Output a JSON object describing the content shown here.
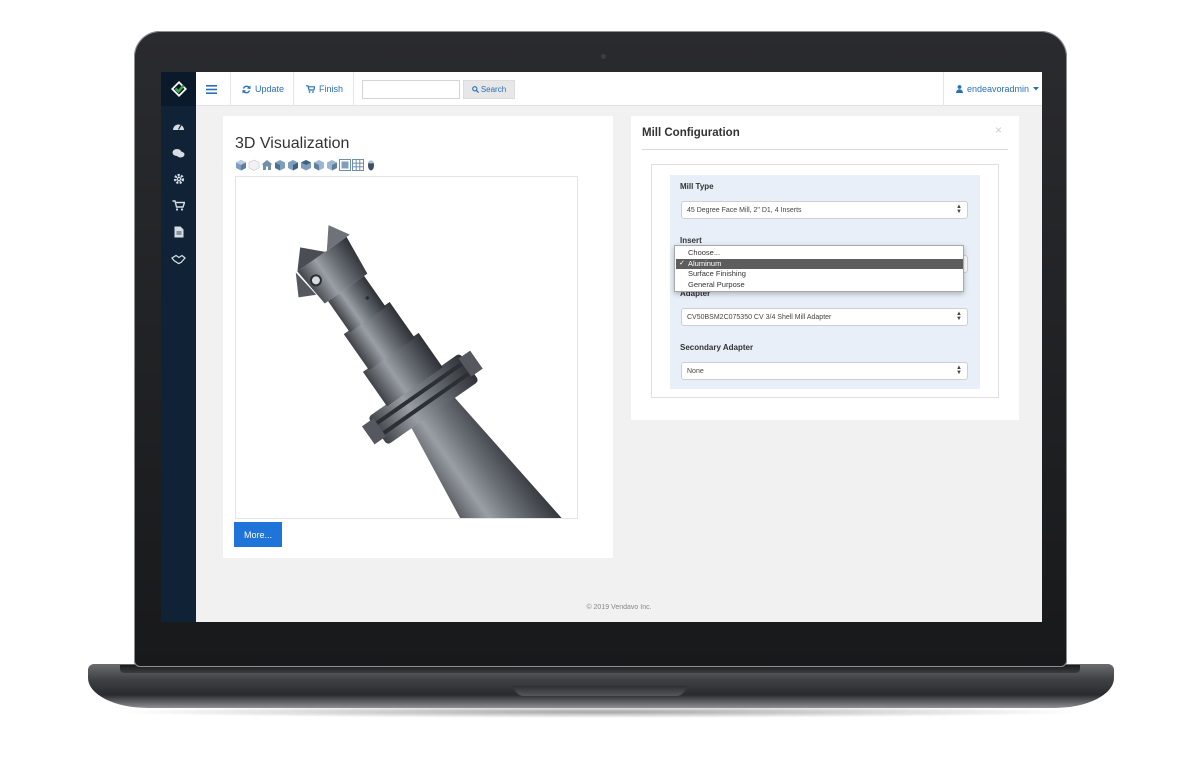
{
  "topbar": {
    "update_label": "Update",
    "finish_label": "Finish",
    "search_placeholder": "",
    "search_button_label": "Search",
    "user_label": "endeavoradmin"
  },
  "sidebar": {
    "items": [
      {
        "icon": "dashboard-icon"
      },
      {
        "icon": "comments-icon"
      },
      {
        "icon": "gear-icon"
      },
      {
        "icon": "cart-icon"
      },
      {
        "icon": "document-icon"
      },
      {
        "icon": "handshake-icon"
      }
    ]
  },
  "visualization": {
    "title": "3D Visualization",
    "more_button": "More..."
  },
  "config": {
    "title": "Mill Configuration",
    "close": "×",
    "mill_type": {
      "label": "Mill Type",
      "value": "45 Degree Face Mill, 2\" D1, 4 Inserts"
    },
    "insert": {
      "label": "Insert",
      "options": [
        "Choose...",
        "Aluminum",
        "Surface Finishing",
        "General Purpose"
      ],
      "selected": "Aluminum"
    },
    "adapter": {
      "label": "Adapter",
      "value": "CV50BSM2C075350 CV 3/4 Shell Mill Adapter"
    },
    "secondary_adapter": {
      "label": "Secondary Adapter",
      "value": "None"
    }
  },
  "footer": "© 2019 Vendavo Inc.",
  "colors": {
    "sidebar": "#0f2236",
    "accent": "#2a6fb8",
    "button_primary": "#1f74d9",
    "logo_green": "#3ea84a"
  }
}
